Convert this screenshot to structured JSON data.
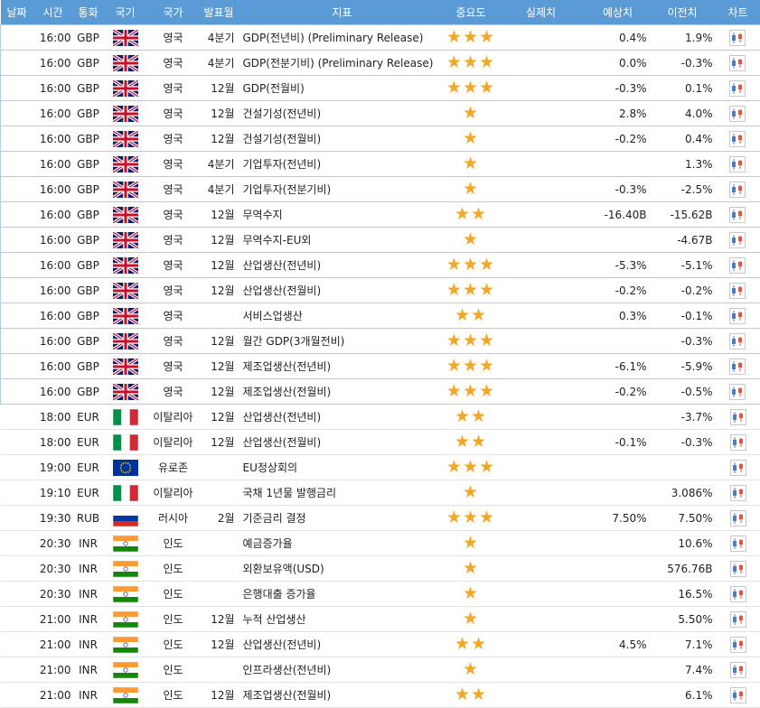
{
  "headers": {
    "date": "날짜",
    "time": "시간",
    "currency": "통화",
    "flag": "국기",
    "country": "국가",
    "period": "발표월",
    "indicator": "지표",
    "importance": "중요도",
    "actual": "실제치",
    "forecast": "예상치",
    "previous": "이전치",
    "chart": "차트"
  },
  "icons": {
    "star": "star-icon",
    "chart": "chart-icon"
  },
  "colors": {
    "header_bg": "#5b9bd5",
    "star": "#f5a623",
    "highlight_border": "#a8d0ec"
  },
  "rows": [
    {
      "time": "16:00",
      "currency": "GBP",
      "flag": "uk",
      "country": "영국",
      "period": "4분기",
      "indicator": "GDP(전년비) (Preliminary Release)",
      "importance": 3,
      "actual": "",
      "forecast": "0.4%",
      "previous": "1.9%",
      "highlight": true
    },
    {
      "time": "16:00",
      "currency": "GBP",
      "flag": "uk",
      "country": "영국",
      "period": "4분기",
      "indicator": "GDP(전분기비) (Preliminary Release)",
      "importance": 3,
      "actual": "",
      "forecast": "0.0%",
      "previous": "-0.3%",
      "highlight": true
    },
    {
      "time": "16:00",
      "currency": "GBP",
      "flag": "uk",
      "country": "영국",
      "period": "12월",
      "indicator": "GDP(전월비)",
      "importance": 3,
      "actual": "",
      "forecast": "-0.3%",
      "previous": "0.1%",
      "highlight": true
    },
    {
      "time": "16:00",
      "currency": "GBP",
      "flag": "uk",
      "country": "영국",
      "period": "12월",
      "indicator": "건설기성(전년비)",
      "importance": 1,
      "actual": "",
      "forecast": "2.8%",
      "previous": "4.0%",
      "highlight": true
    },
    {
      "time": "16:00",
      "currency": "GBP",
      "flag": "uk",
      "country": "영국",
      "period": "12월",
      "indicator": "건설기성(전월비)",
      "importance": 1,
      "actual": "",
      "forecast": "-0.2%",
      "previous": "0.4%",
      "highlight": true
    },
    {
      "time": "16:00",
      "currency": "GBP",
      "flag": "uk",
      "country": "영국",
      "period": "4분기",
      "indicator": "기업투자(전년비)",
      "importance": 1,
      "actual": "",
      "forecast": "",
      "previous": "1.3%",
      "highlight": true
    },
    {
      "time": "16:00",
      "currency": "GBP",
      "flag": "uk",
      "country": "영국",
      "period": "4분기",
      "indicator": "기업투자(전분기비)",
      "importance": 1,
      "actual": "",
      "forecast": "-0.3%",
      "previous": "-2.5%",
      "highlight": true
    },
    {
      "time": "16:00",
      "currency": "GBP",
      "flag": "uk",
      "country": "영국",
      "period": "12월",
      "indicator": "무역수지",
      "importance": 2,
      "actual": "",
      "forecast": "-16.40B",
      "previous": "-15.62B",
      "highlight": true
    },
    {
      "time": "16:00",
      "currency": "GBP",
      "flag": "uk",
      "country": "영국",
      "period": "12월",
      "indicator": "무역수지-EU외",
      "importance": 1,
      "actual": "",
      "forecast": "",
      "previous": "-4.67B",
      "highlight": true
    },
    {
      "time": "16:00",
      "currency": "GBP",
      "flag": "uk",
      "country": "영국",
      "period": "12월",
      "indicator": "산업생산(전년비)",
      "importance": 3,
      "actual": "",
      "forecast": "-5.3%",
      "previous": "-5.1%",
      "highlight": true
    },
    {
      "time": "16:00",
      "currency": "GBP",
      "flag": "uk",
      "country": "영국",
      "period": "12월",
      "indicator": "산업생산(전월비)",
      "importance": 3,
      "actual": "",
      "forecast": "-0.2%",
      "previous": "-0.2%",
      "highlight": true
    },
    {
      "time": "16:00",
      "currency": "GBP",
      "flag": "uk",
      "country": "영국",
      "period": "",
      "indicator": "서비스업생산",
      "importance": 2,
      "actual": "",
      "forecast": "0.3%",
      "previous": "-0.1%",
      "highlight": true
    },
    {
      "time": "16:00",
      "currency": "GBP",
      "flag": "uk",
      "country": "영국",
      "period": "12월",
      "indicator": "월간 GDP(3개월전비)",
      "importance": 3,
      "actual": "",
      "forecast": "",
      "previous": "-0.3%",
      "highlight": true
    },
    {
      "time": "16:00",
      "currency": "GBP",
      "flag": "uk",
      "country": "영국",
      "period": "12월",
      "indicator": "제조업생산(전년비)",
      "importance": 3,
      "actual": "",
      "forecast": "-6.1%",
      "previous": "-5.9%",
      "highlight": true
    },
    {
      "time": "16:00",
      "currency": "GBP",
      "flag": "uk",
      "country": "영국",
      "period": "12월",
      "indicator": "제조업생산(전월비)",
      "importance": 3,
      "actual": "",
      "forecast": "-0.2%",
      "previous": "-0.5%",
      "highlight": true
    },
    {
      "time": "18:00",
      "currency": "EUR",
      "flag": "it",
      "country": "이탈리아",
      "period": "12월",
      "indicator": "산업생산(전년비)",
      "importance": 2,
      "actual": "",
      "forecast": "",
      "previous": "-3.7%",
      "highlight": false
    },
    {
      "time": "18:00",
      "currency": "EUR",
      "flag": "it",
      "country": "이탈리아",
      "period": "12월",
      "indicator": "산업생산(전월비)",
      "importance": 2,
      "actual": "",
      "forecast": "-0.1%",
      "previous": "-0.3%",
      "highlight": false
    },
    {
      "time": "19:00",
      "currency": "EUR",
      "flag": "eu",
      "country": "유로존",
      "period": "",
      "indicator": "EU정상회의",
      "importance": 3,
      "actual": "",
      "forecast": "",
      "previous": "",
      "highlight": false
    },
    {
      "time": "19:10",
      "currency": "EUR",
      "flag": "it",
      "country": "이탈리아",
      "period": "",
      "indicator": "국채 1년물 발행금리",
      "importance": 1,
      "actual": "",
      "forecast": "",
      "previous": "3.086%",
      "highlight": false
    },
    {
      "time": "19:30",
      "currency": "RUB",
      "flag": "ru",
      "country": "러시아",
      "period": "2월",
      "indicator": "기준금리 결정",
      "importance": 3,
      "actual": "",
      "forecast": "7.50%",
      "previous": "7.50%",
      "highlight": false
    },
    {
      "time": "20:30",
      "currency": "INR",
      "flag": "in",
      "country": "인도",
      "period": "",
      "indicator": "예금증가율",
      "importance": 1,
      "actual": "",
      "forecast": "",
      "previous": "10.6%",
      "highlight": false
    },
    {
      "time": "20:30",
      "currency": "INR",
      "flag": "in",
      "country": "인도",
      "period": "",
      "indicator": "외환보유액(USD)",
      "importance": 1,
      "actual": "",
      "forecast": "",
      "previous": "576.76B",
      "highlight": false
    },
    {
      "time": "20:30",
      "currency": "INR",
      "flag": "in",
      "country": "인도",
      "period": "",
      "indicator": "은행대출 증가율",
      "importance": 1,
      "actual": "",
      "forecast": "",
      "previous": "16.5%",
      "highlight": false
    },
    {
      "time": "21:00",
      "currency": "INR",
      "flag": "in",
      "country": "인도",
      "period": "12월",
      "indicator": "누적 산업생산",
      "importance": 1,
      "actual": "",
      "forecast": "",
      "previous": "5.50%",
      "highlight": false
    },
    {
      "time": "21:00",
      "currency": "INR",
      "flag": "in",
      "country": "인도",
      "period": "12월",
      "indicator": "산업생산(전년비)",
      "importance": 2,
      "actual": "",
      "forecast": "4.5%",
      "previous": "7.1%",
      "highlight": false
    },
    {
      "time": "21:00",
      "currency": "INR",
      "flag": "in",
      "country": "인도",
      "period": "",
      "indicator": "인프라생산(전년비)",
      "importance": 1,
      "actual": "",
      "forecast": "",
      "previous": "7.4%",
      "highlight": false
    },
    {
      "time": "21:00",
      "currency": "INR",
      "flag": "in",
      "country": "인도",
      "period": "12월",
      "indicator": "제조업생산(전월비)",
      "importance": 2,
      "actual": "",
      "forecast": "",
      "previous": "6.1%",
      "highlight": false
    }
  ]
}
